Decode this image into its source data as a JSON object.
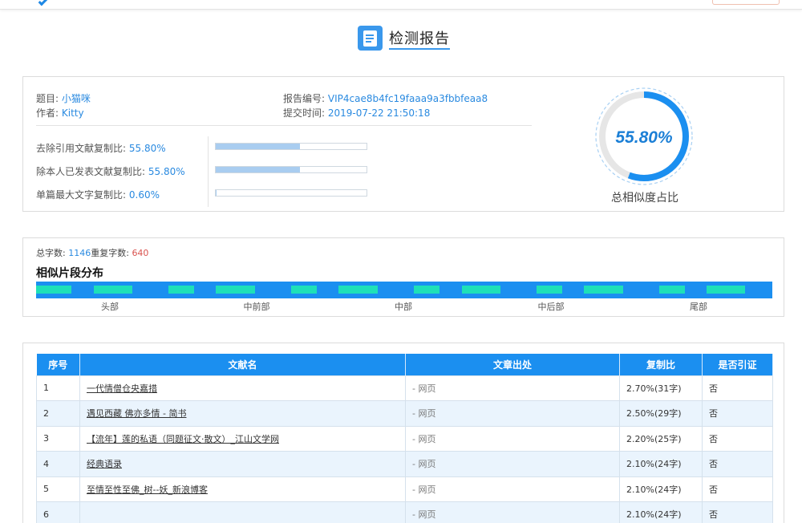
{
  "header": {
    "title": "检测报告"
  },
  "report": {
    "title_label": "题目:",
    "title_value": "小猫咪",
    "author_label": "作者:",
    "author_value": "Kitty",
    "id_label": "报告编号:",
    "id_value": "VIP4cae8b4fc19faaa9a3fbbfeaa8",
    "time_label": "提交时间:",
    "time_value": "2019-07-22 21:50:18"
  },
  "ratios": [
    {
      "label": "去除引用文献复制比:",
      "value": "55.80%",
      "fraction": 0.558
    },
    {
      "label": "除本人已发表文献复制比:",
      "value": "55.80%",
      "fraction": 0.558
    },
    {
      "label": "单篇最大文字复制比:",
      "value": "0.60%",
      "fraction": 0.006
    }
  ],
  "gauge": {
    "value": "55.80%",
    "fraction": 0.558,
    "label": "总相似度占比"
  },
  "counts": {
    "total_label": "总字数:",
    "total": "1146",
    "dup_label": "重复字数:",
    "dup": "640"
  },
  "distribution": {
    "title": "相似片段分布",
    "labels": [
      "头部",
      "中前部",
      "中部",
      "中后部",
      "尾部"
    ]
  },
  "table": {
    "headers": [
      "序号",
      "文献名",
      "文章出处",
      "复制比",
      "是否引证"
    ],
    "rows": [
      {
        "no": "1",
        "name": "一代情僧仓央嘉措",
        "source": "- 网页",
        "ratio": "2.70%(31字)",
        "cited": "否"
      },
      {
        "no": "2",
        "name": "遇见西藏 佛亦多情 - 简书",
        "source": "- 网页",
        "ratio": "2.50%(29字)",
        "cited": "否"
      },
      {
        "no": "3",
        "name": "【流年】莲的私语（同题征文·散文）_江山文学网",
        "source": "- 网页",
        "ratio": "2.20%(25字)",
        "cited": "否"
      },
      {
        "no": "4",
        "name": "经典语录",
        "source": "- 网页",
        "ratio": "2.10%(24字)",
        "cited": "否"
      },
      {
        "no": "5",
        "name": "至情至性至佛_树--妖_新浪博客",
        "source": "- 网页",
        "ratio": "2.10%(24字)",
        "cited": "否"
      },
      {
        "no": "6",
        "name": "",
        "source": "- 网页",
        "ratio": "2.10%(24字)",
        "cited": "否"
      }
    ]
  },
  "colors": {
    "accent": "#1b8ff0",
    "segment": "#1ee0b8",
    "value_text": "#2a8ae0",
    "dup_text": "#d9534f"
  }
}
